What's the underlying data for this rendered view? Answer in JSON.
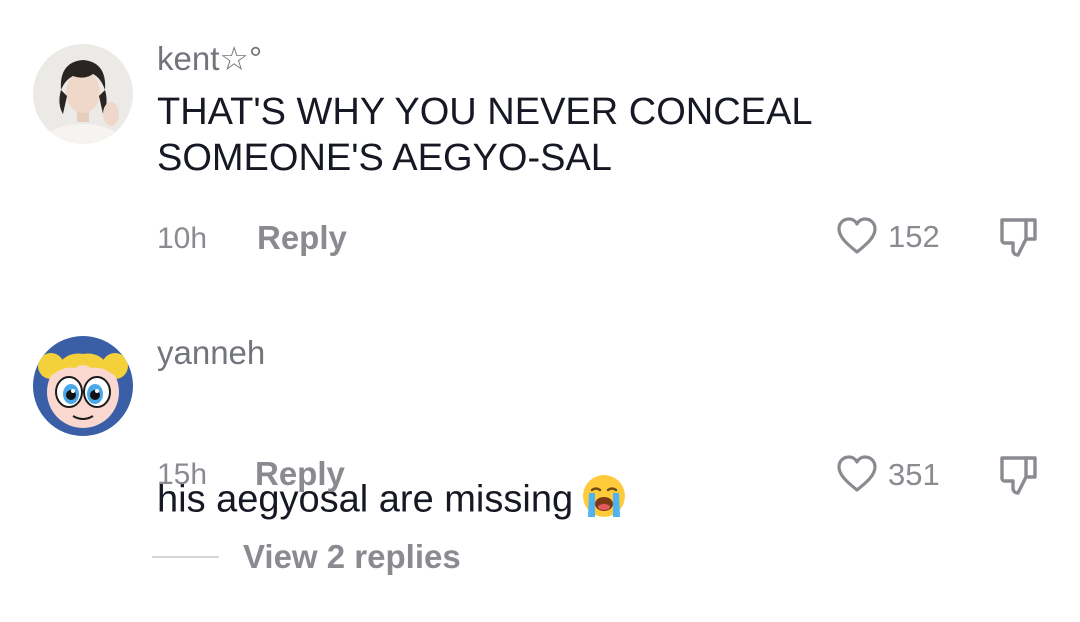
{
  "comments": [
    {
      "username": "kent☆°",
      "text": "THAT'S WHY YOU NEVER CONCEAL\nSOMEONE'S AEGYO-SAL",
      "time": "10h",
      "reply_label": "Reply",
      "likes": "152",
      "avatar": "person-photo-avatar",
      "emoji": ""
    },
    {
      "username": "yanneh",
      "text": "his aegyosal are missing",
      "time": "15h",
      "reply_label": "Reply",
      "likes": "351",
      "avatar": "cartoon-girl-avatar",
      "emoji": "loudly-crying-face"
    }
  ],
  "view_replies_label": "View 2 replies",
  "icons": {
    "like": "heart-outline-icon",
    "dislike": "thumbs-down-outline-icon"
  },
  "colors": {
    "primary_text": "#161823",
    "secondary_text": "#8a8b91",
    "divider": "#d6d6d8"
  }
}
